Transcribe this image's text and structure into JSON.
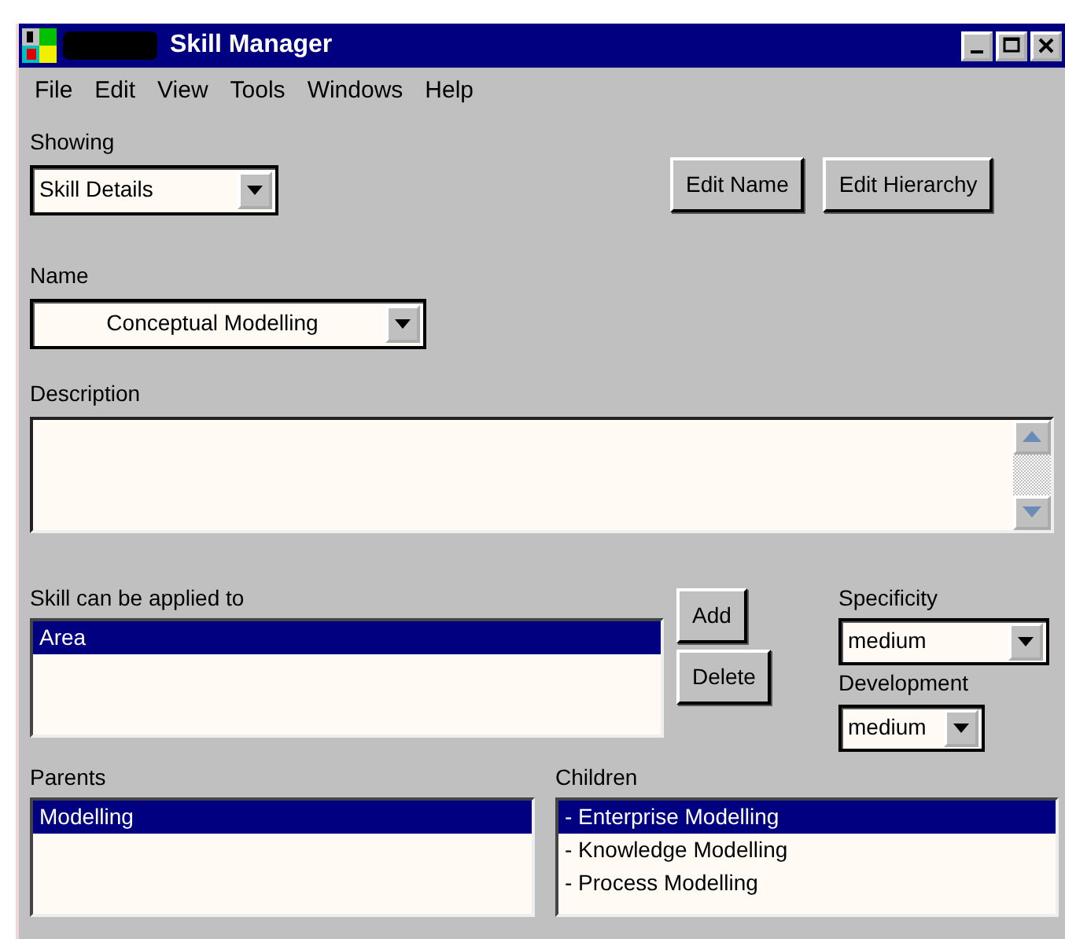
{
  "window": {
    "title": "Skill Manager"
  },
  "menu": [
    {
      "label": "File"
    },
    {
      "label": "Edit"
    },
    {
      "label": "View"
    },
    {
      "label": "Tools"
    },
    {
      "label": "Windows"
    },
    {
      "label": "Help"
    }
  ],
  "showing": {
    "label": "Showing",
    "value": "Skill Details"
  },
  "buttons": [
    "Edit Name",
    "Edit Hierarchy"
  ],
  "name": {
    "label": "Name",
    "value": "Conceptual Modelling"
  },
  "description": {
    "label": "Description"
  },
  "applied_to": {
    "label": "Skill can be applied to",
    "items": [
      {
        "label": "Area",
        "selected": true
      }
    ]
  },
  "applied_buttons": [
    "Add",
    "Delete"
  ],
  "specificity": {
    "label": "Specificity",
    "value": "medium"
  },
  "development": {
    "label": "Development",
    "value": "medium"
  },
  "parents": {
    "label": "Parents",
    "items": [
      {
        "label": "Modelling",
        "selected": true
      }
    ]
  },
  "children": {
    "label": "Children",
    "items": [
      {
        "label": "- Enterprise Modelling",
        "selected": true
      },
      {
        "label": "- Knowledge Modelling",
        "selected": false
      },
      {
        "label": "- Process Modelling",
        "selected": false
      }
    ]
  }
}
